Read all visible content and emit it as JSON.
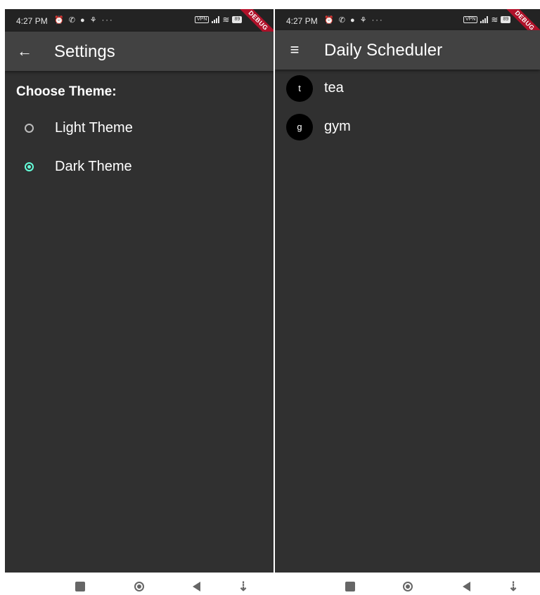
{
  "left_screen": {
    "status": {
      "time": "4:27 PM",
      "left_icons": "⏰ ✆ ● ⚘ ···",
      "vpn": "VPN",
      "battery": "89"
    },
    "debug_banner": "DEBUG",
    "appbar": {
      "back_icon": "arrow-back-icon",
      "title": "Settings"
    },
    "section_title": "Choose Theme:",
    "radio_options": [
      {
        "label": "Light Theme",
        "selected": false
      },
      {
        "label": "Dark Theme",
        "selected": true
      }
    ]
  },
  "right_screen": {
    "status": {
      "time": "4:27 PM",
      "left_icons": "⏰ ✆ ● ⚘ ···",
      "vpn": "VPN",
      "battery": "89"
    },
    "debug_banner": "DEBUG",
    "appbar": {
      "menu_icon": "menu-icon",
      "title": "Daily Scheduler"
    },
    "items": [
      {
        "avatar": "t",
        "title": "tea"
      },
      {
        "avatar": "g",
        "title": "gym"
      }
    ]
  },
  "navbar": {
    "buttons": [
      "recents-button",
      "home-button",
      "back-button",
      "assistant-button"
    ]
  },
  "colors": {
    "background": "#303030",
    "appbar": "#424242",
    "status_bar": "#232323",
    "accent": "#64ffda",
    "debug_ribbon": "#b0122a"
  }
}
